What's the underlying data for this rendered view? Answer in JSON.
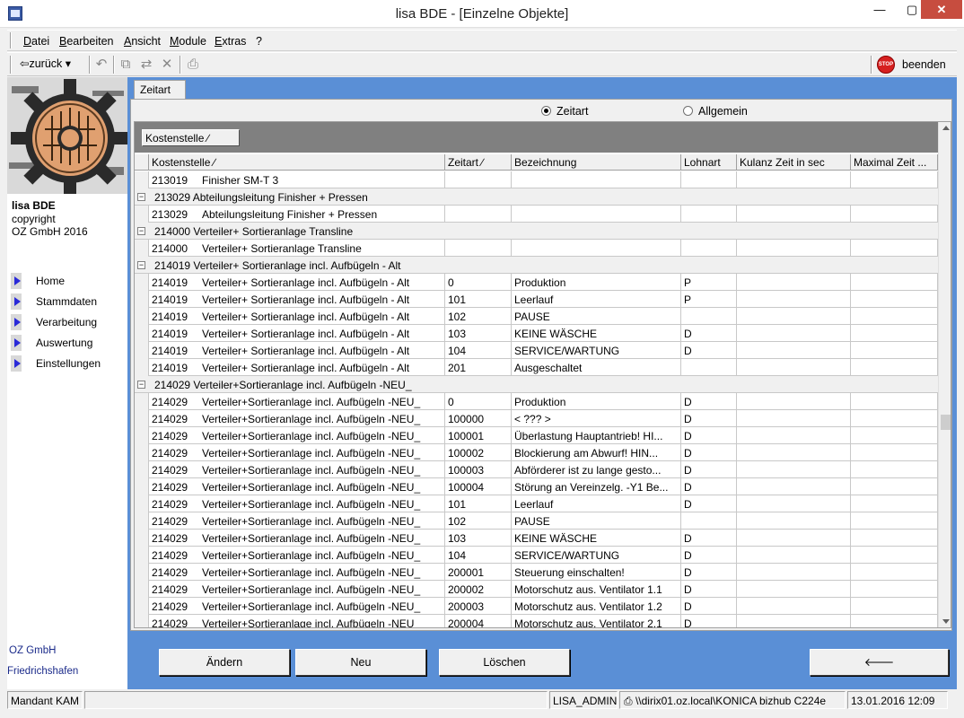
{
  "window": {
    "title": "lisa    BDE - [Einzelne Objekte]",
    "min": "—",
    "max": "▢",
    "close": "✕"
  },
  "menu": [
    "Datei",
    "Bearbeiten",
    "Ansicht",
    "Module",
    "Extras",
    "?"
  ],
  "toolbar": {
    "back_label": "⇦zurück ▾",
    "quit_label": "beenden",
    "stop_label": "STOP",
    "icons": [
      "undo-icon",
      "copy-object-icon",
      "move-object-icon",
      "delete-icon",
      "print-icon"
    ]
  },
  "sidebar": {
    "app_name": "lisa BDE",
    "copyright": "copyright",
    "company_year": "OZ GmbH 2016",
    "nav": [
      "Home",
      "Stammdaten",
      "Verarbeitung",
      "Auswertung",
      "Einstellungen"
    ],
    "footer_company": "OZ GmbH",
    "footer_city": "Friedrichshafen"
  },
  "tab": "Zeitart",
  "radios": [
    {
      "label": "Zeitart",
      "checked": true
    },
    {
      "label": "Allgemein",
      "checked": false
    }
  ],
  "grid": {
    "group_chip": "Kostenstelle ∕",
    "columns": [
      "Kostenstelle ∕",
      "Zeitart ∕",
      "Bezeichnung",
      "Lohnart",
      "Kulanz Zeit in sec",
      "Maximal Zeit ..."
    ],
    "rows": [
      {
        "type": "data",
        "cells": [
          "213019",
          "Finisher SM-T 3",
          "",
          "",
          "",
          "",
          ""
        ]
      },
      {
        "type": "group",
        "label": "213029    Abteilungsleitung Finisher + Pressen"
      },
      {
        "type": "data",
        "cells": [
          "213029",
          "Abteilungsleitung Finisher + Pressen",
          "",
          "",
          "",
          "",
          ""
        ]
      },
      {
        "type": "group",
        "label": "214000    Verteiler+ Sortieranlage Transline"
      },
      {
        "type": "data",
        "cells": [
          "214000",
          "Verteiler+ Sortieranlage Transline",
          "",
          "",
          "",
          "",
          ""
        ]
      },
      {
        "type": "group",
        "label": "214019    Verteiler+ Sortieranlage incl. Aufbügeln - Alt"
      },
      {
        "type": "data",
        "cells": [
          "214019",
          "Verteiler+ Sortieranlage incl. Aufbügeln - Alt",
          "0",
          "Produktion",
          "P",
          "",
          ""
        ]
      },
      {
        "type": "data",
        "cells": [
          "214019",
          "Verteiler+ Sortieranlage incl. Aufbügeln - Alt",
          "101",
          "Leerlauf",
          "P",
          "",
          ""
        ]
      },
      {
        "type": "data",
        "cells": [
          "214019",
          "Verteiler+ Sortieranlage incl. Aufbügeln - Alt",
          "102",
          "PAUSE",
          "",
          "",
          ""
        ]
      },
      {
        "type": "data",
        "cells": [
          "214019",
          "Verteiler+ Sortieranlage incl. Aufbügeln - Alt",
          "103",
          "KEINE WÄSCHE",
          "D",
          "",
          ""
        ]
      },
      {
        "type": "data",
        "cells": [
          "214019",
          "Verteiler+ Sortieranlage incl. Aufbügeln - Alt",
          "104",
          "SERVICE/WARTUNG",
          "D",
          "",
          ""
        ]
      },
      {
        "type": "data",
        "cells": [
          "214019",
          "Verteiler+ Sortieranlage incl. Aufbügeln - Alt",
          "201",
          "Ausgeschaltet",
          "",
          "",
          ""
        ]
      },
      {
        "type": "group",
        "label": "214029    Verteiler+Sortieranlage incl. Aufbügeln -NEU_"
      },
      {
        "type": "data",
        "cells": [
          "214029",
          "Verteiler+Sortieranlage incl. Aufbügeln -NEU_",
          "0",
          "Produktion",
          "D",
          "",
          ""
        ]
      },
      {
        "type": "data",
        "cells": [
          "214029",
          "Verteiler+Sortieranlage incl. Aufbügeln -NEU_",
          "100000",
          "< ??? >",
          "D",
          "",
          ""
        ]
      },
      {
        "type": "data",
        "cells": [
          "214029",
          "Verteiler+Sortieranlage incl. Aufbügeln -NEU_",
          "100001",
          "Überlastung Hauptantrieb! HI...",
          "D",
          "",
          ""
        ]
      },
      {
        "type": "data",
        "cells": [
          "214029",
          "Verteiler+Sortieranlage incl. Aufbügeln -NEU_",
          "100002",
          "Blockierung am Abwurf! HIN...",
          "D",
          "",
          ""
        ]
      },
      {
        "type": "data",
        "cells": [
          "214029",
          "Verteiler+Sortieranlage incl. Aufbügeln -NEU_",
          "100003",
          "Abförderer ist zu lange gesto...",
          "D",
          "",
          ""
        ]
      },
      {
        "type": "data",
        "cells": [
          "214029",
          "Verteiler+Sortieranlage incl. Aufbügeln -NEU_",
          "100004",
          "Störung an Vereinzelg. -Y1 Be...",
          "D",
          "",
          ""
        ]
      },
      {
        "type": "data",
        "cells": [
          "214029",
          "Verteiler+Sortieranlage incl. Aufbügeln -NEU_",
          "101",
          "Leerlauf",
          "D",
          "",
          ""
        ]
      },
      {
        "type": "data",
        "cells": [
          "214029",
          "Verteiler+Sortieranlage incl. Aufbügeln -NEU_",
          "102",
          "PAUSE",
          "",
          "",
          ""
        ]
      },
      {
        "type": "data",
        "cells": [
          "214029",
          "Verteiler+Sortieranlage incl. Aufbügeln -NEU_",
          "103",
          "KEINE WÄSCHE",
          "D",
          "",
          ""
        ]
      },
      {
        "type": "data",
        "cells": [
          "214029",
          "Verteiler+Sortieranlage incl. Aufbügeln -NEU_",
          "104",
          "SERVICE/WARTUNG",
          "D",
          "",
          ""
        ]
      },
      {
        "type": "data",
        "cells": [
          "214029",
          "Verteiler+Sortieranlage incl. Aufbügeln -NEU_",
          "200001",
          "Steuerung einschalten!",
          "D",
          "",
          ""
        ]
      },
      {
        "type": "data",
        "cells": [
          "214029",
          "Verteiler+Sortieranlage incl. Aufbügeln -NEU_",
          "200002",
          "Motorschutz aus. Ventilator 1.1",
          "D",
          "",
          ""
        ]
      },
      {
        "type": "data",
        "cells": [
          "214029",
          "Verteiler+Sortieranlage incl. Aufbügeln -NEU_",
          "200003",
          "Motorschutz aus. Ventilator 1.2",
          "D",
          "",
          ""
        ]
      },
      {
        "type": "data",
        "cells": [
          "214029",
          "Verteiler+Sortieranlage incl. Aufbügeln -NEU_",
          "200004",
          "Motorschutz aus. Ventilator 2.1",
          "D",
          "",
          ""
        ]
      }
    ]
  },
  "buttons": {
    "change": "Ändern",
    "new": "Neu",
    "delete": "Löschen",
    "back": "🡐"
  },
  "status": {
    "mandant": "Mandant KAM",
    "user": "LISA_ADMIN",
    "printer": "\\\\dirix01.oz.local\\KONICA bizhub C224e",
    "datetime": "13.01.2016 12:09"
  },
  "colors": {
    "accent_panel": "#5a8fd6",
    "nav_arrow": "#2a2ad8",
    "footer_text": "#1a2a8a"
  }
}
